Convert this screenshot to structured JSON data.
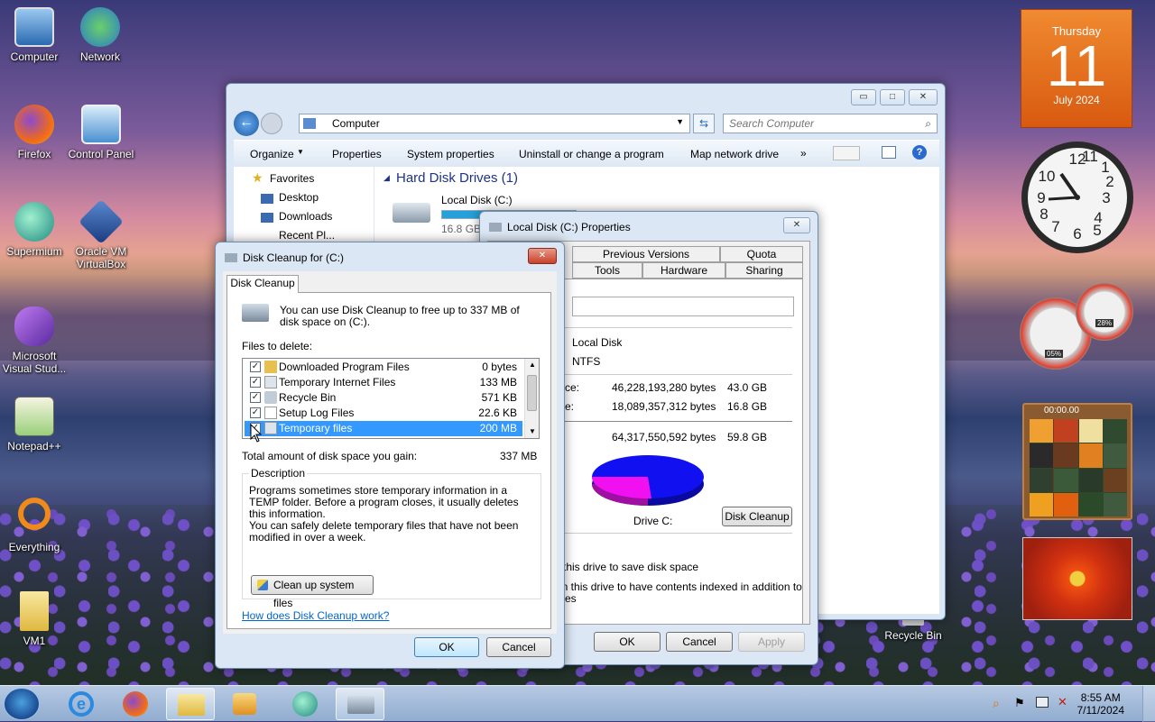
{
  "desktop": {
    "icons": [
      {
        "label": "Computer"
      },
      {
        "label": "Network"
      },
      {
        "label": "Firefox"
      },
      {
        "label": "Control Panel"
      },
      {
        "label": "Supermium"
      },
      {
        "label": "Oracle VM VirtualBox"
      },
      {
        "label": "Microsoft Visual Stud..."
      },
      {
        "label": "Notepad++"
      },
      {
        "label": "Everything"
      },
      {
        "label": "VM1"
      },
      {
        "label": "Recycle Bin"
      }
    ]
  },
  "calendar": {
    "weekday": "Thursday",
    "day": "11",
    "month_year": "July 2024"
  },
  "meters": {
    "cpu": "05%",
    "ram": "28%"
  },
  "puzzle": {
    "timer": "00:00.00"
  },
  "explorer": {
    "address": "Computer",
    "search_placeholder": "Search Computer",
    "toolbar": [
      "Organize",
      "Properties",
      "System properties",
      "Uninstall or change a program",
      "Map network drive",
      "»"
    ],
    "nav": {
      "favorites": "Favorites",
      "desktop": "Desktop",
      "downloads": "Downloads",
      "recent": "Recent Pl..."
    },
    "section": "Hard Disk Drives (1)",
    "drive": {
      "name": "Local Disk (C:)",
      "free": "16.8 GB"
    }
  },
  "properties": {
    "title": "Local Disk (C:) Properties",
    "tabs_top": [
      "Previous Versions",
      "Quota"
    ],
    "tabs_bottom": [
      "Tools",
      "Hardware",
      "Sharing"
    ],
    "type_value": "Local Disk",
    "fs_value": "NTFS",
    "used_label": "ce:",
    "used_bytes": "46,228,193,280 bytes",
    "used_gb": "43.0 GB",
    "free_label": "e:",
    "free_bytes": "18,089,357,312 bytes",
    "free_gb": "16.8 GB",
    "cap_bytes": "64,317,550,592 bytes",
    "cap_gb": "59.8 GB",
    "drive_label": "Drive C:",
    "cleanup_btn": "Disk Cleanup",
    "compress_text": "this drive to save disk space",
    "index_text": "on this drive to have contents indexed in addition to",
    "index_text2": "es",
    "ok": "OK",
    "cancel": "Cancel",
    "apply": "Apply",
    "colors": {
      "used": "#1010f0",
      "free": "#f010f0"
    }
  },
  "cleanup": {
    "title": "Disk Cleanup for  (C:)",
    "tab": "Disk Cleanup",
    "intro": "You can use Disk Cleanup to free up to 337 MB of disk space on  (C:).",
    "files_label": "Files to delete:",
    "files": [
      {
        "name": "Downloaded Program Files",
        "size": "0 bytes",
        "checked": true
      },
      {
        "name": "Temporary Internet Files",
        "size": "133 MB",
        "checked": true
      },
      {
        "name": "Recycle Bin",
        "size": "571 KB",
        "checked": true
      },
      {
        "name": "Setup Log Files",
        "size": "22.6 KB",
        "checked": true
      },
      {
        "name": "Temporary files",
        "size": "200 MB",
        "checked": true
      }
    ],
    "total_label": "Total amount of disk space you gain:",
    "total_value": "337 MB",
    "desc_label": "Description",
    "desc1": "Programs sometimes store temporary information in a TEMP folder. Before a program closes, it usually deletes this information.",
    "desc2": "You can safely delete temporary files that have not been modified in over a week.",
    "sysfiles_btn": "Clean up system files",
    "help_link": "How does Disk Cleanup work?",
    "ok": "OK",
    "cancel": "Cancel"
  },
  "taskbar": {
    "time": "8:55 AM",
    "date": "7/11/2024"
  }
}
